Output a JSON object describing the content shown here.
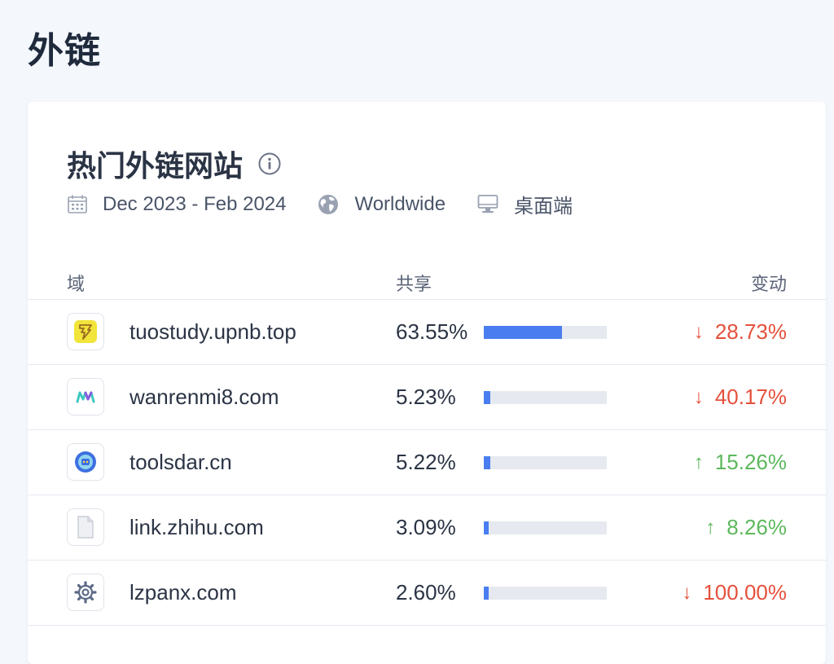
{
  "page": {
    "title": "外链"
  },
  "card": {
    "title": "热门外链网站",
    "date_range": "Dec 2023 - Feb 2024",
    "region": "Worldwide",
    "device": "桌面端"
  },
  "table": {
    "headers": {
      "domain": "域",
      "share": "共享",
      "change": "变动"
    },
    "rows": [
      {
        "domain": "tuostudy.upnb.top",
        "share_label": "63.55%",
        "share": 63.55,
        "direction": "down",
        "arrow": "↓",
        "change": "28.73%",
        "favicon": "tuostudy-logo-icon"
      },
      {
        "domain": "wanrenmi8.com",
        "share_label": "5.23%",
        "share": 5.23,
        "direction": "down",
        "arrow": "↓",
        "change": "40.17%",
        "favicon": "wanrenmi-logo-icon"
      },
      {
        "domain": "toolsdar.cn",
        "share_label": "5.22%",
        "share": 5.22,
        "direction": "up",
        "arrow": "↑",
        "change": "15.26%",
        "favicon": "toolsdar-logo-icon"
      },
      {
        "domain": "link.zhihu.com",
        "share_label": "3.09%",
        "share": 3.09,
        "direction": "up",
        "arrow": "↑",
        "change": "8.26%",
        "favicon": "document-icon"
      },
      {
        "domain": "lzpanx.com",
        "share_label": "2.60%",
        "share": 2.6,
        "direction": "down",
        "arrow": "↓",
        "change": "100.00%",
        "favicon": "gear-icon"
      }
    ]
  },
  "colors": {
    "bar": "#4a7ef0",
    "bar_track": "#e6e9ef",
    "down": "#e5503c",
    "up": "#5cb85c"
  }
}
